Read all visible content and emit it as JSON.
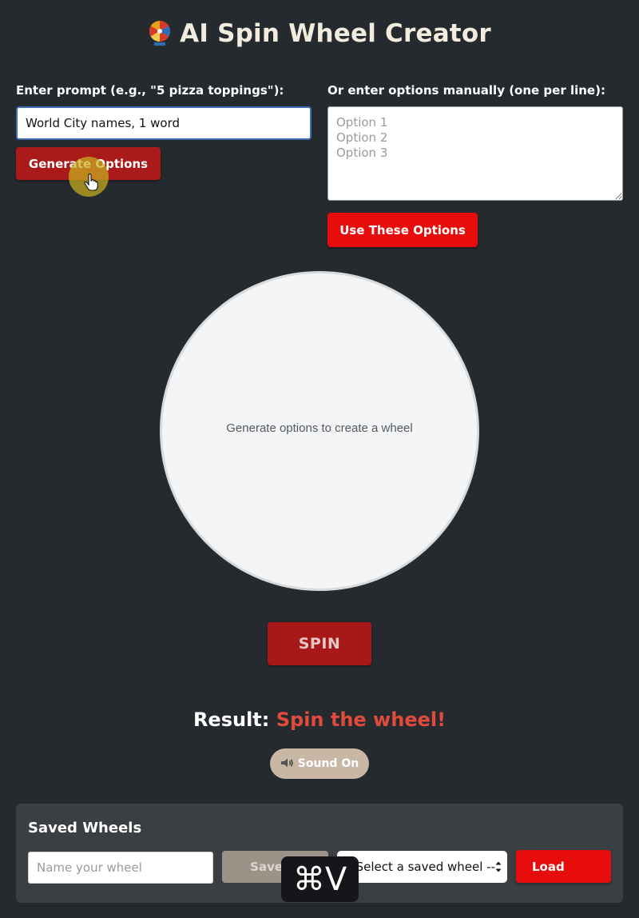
{
  "app": {
    "title": "AI Spin Wheel Creator",
    "title_icon": "spin-wheel-icon"
  },
  "prompt_section": {
    "label": "Enter prompt (e.g., \"5 pizza toppings\"):",
    "input_value": "World City names, 1 word",
    "generate_label": "Generate Options"
  },
  "manual_section": {
    "label": "Or enter options manually (one per line):",
    "placeholder": "Option 1\nOption 2\nOption 3",
    "use_label": "Use These Options"
  },
  "wheel": {
    "empty_message": "Generate options to create a wheel"
  },
  "spin": {
    "label": "SPIN"
  },
  "result": {
    "label": "Result:",
    "value": "Spin the wheel!"
  },
  "sound": {
    "icon": "speaker-icon",
    "label": "Sound On"
  },
  "saved": {
    "title": "Saved Wheels",
    "name_placeholder": "Name your wheel",
    "save_label": "Save W",
    "select_value": "-- Select a saved wheel --",
    "load_label": "Load"
  },
  "overlay": {
    "shortcut": "⌘V"
  },
  "colors": {
    "background": "#252a2f",
    "primary_red": "#e80d0d",
    "dark_red": "#ab1a1a",
    "result_accent": "#e24a3b",
    "panel": "#3a3f44"
  }
}
